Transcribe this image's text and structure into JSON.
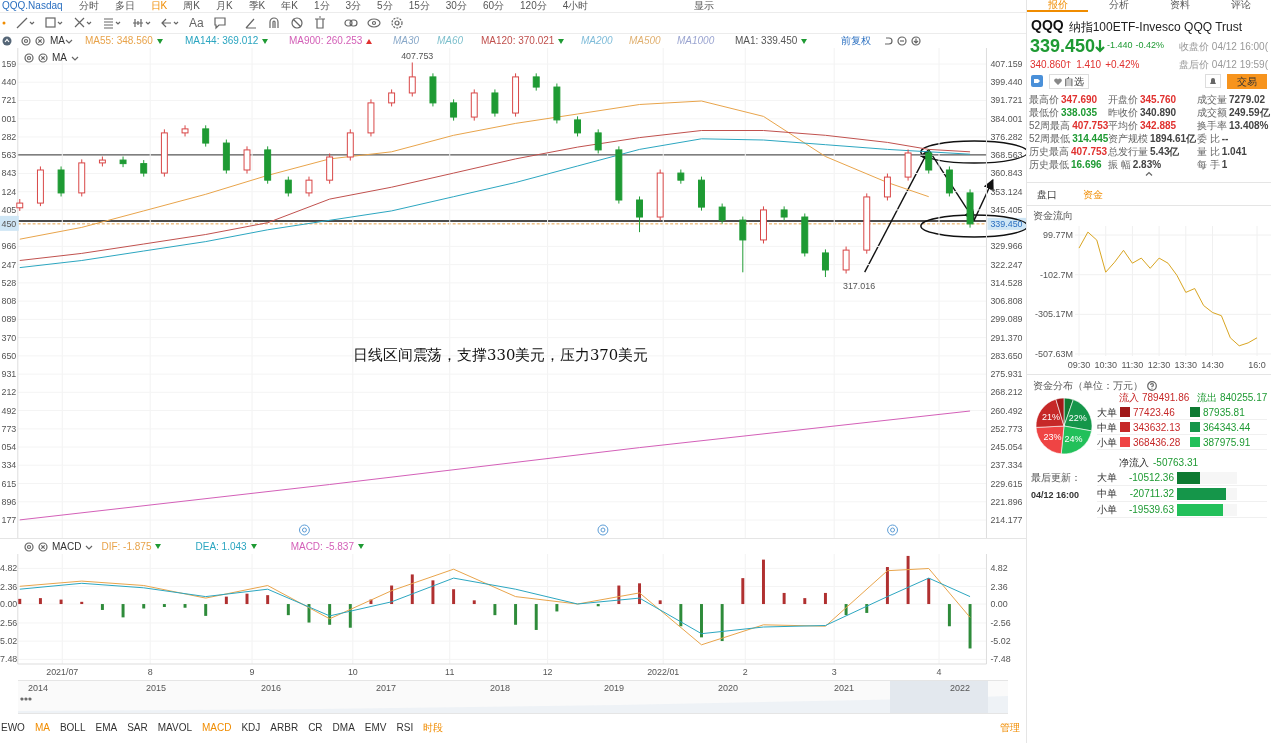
{
  "top_tabs": [
    {
      "label": "QQQ.Nasdaq",
      "selected": false
    },
    {
      "label": "分时",
      "selected": false
    },
    {
      "label": "多日",
      "selected": false
    },
    {
      "label": "日K",
      "selected": true
    },
    {
      "label": "周K",
      "selected": false
    },
    {
      "label": "月K",
      "selected": false
    },
    {
      "label": "季K",
      "selected": false
    },
    {
      "label": "年K",
      "selected": false
    },
    {
      "label": "1分",
      "selected": false
    },
    {
      "label": "3分",
      "selected": false
    },
    {
      "label": "5分",
      "selected": false
    },
    {
      "label": "15分",
      "selected": false
    },
    {
      "label": "30分",
      "selected": false
    },
    {
      "label": "60分",
      "selected": false
    },
    {
      "label": "120分",
      "selected": false
    },
    {
      "label": "4小时",
      "selected": false
    }
  ],
  "display_menu": "显示",
  "text_tool": "Aa",
  "legend_indicator": "MA",
  "ma_legend": [
    {
      "label": "MA55: 348.560",
      "color": "#e8a34a",
      "enabled": true,
      "rising": false
    },
    {
      "label": "MA144: 369.012",
      "color": "#2aa5c0",
      "enabled": true,
      "rising": false
    },
    {
      "label": "MA900: 260.253",
      "color": "#d35fb7",
      "enabled": true,
      "rising": true
    },
    {
      "label": "MA30",
      "color": "#8aa9c9",
      "enabled": false
    },
    {
      "label": "MA60",
      "color": "#7cbfcc",
      "enabled": false
    },
    {
      "label": "MA120: 370.021",
      "color": "#c0504d",
      "enabled": true,
      "rising": false
    },
    {
      "label": "MA200",
      "color": "#7fbcd9",
      "enabled": false
    },
    {
      "label": "MA500",
      "color": "#e0b070",
      "enabled": false
    },
    {
      "label": "MA1000",
      "color": "#9aa4d0",
      "enabled": false
    },
    {
      "label": "MA1: 339.450",
      "color": "#555555",
      "enabled": true,
      "rising": false
    }
  ],
  "adjust_label": "前复权",
  "main_indicator": "MA",
  "main_chart": {
    "chart_data": {
      "type": "candlestick",
      "grid": true,
      "ylim": [
        214.177,
        407.159
      ],
      "yticks": [
        {
          "value": 407.159,
          "label": "407.159"
        },
        {
          "value": 399.44,
          "label": "399.440"
        },
        {
          "value": 391.721,
          "label": "391.721"
        },
        {
          "value": 384.001,
          "label": "384.001"
        },
        {
          "value": 376.282,
          "label": "376.282"
        },
        {
          "value": 368.563,
          "label": "368.563"
        },
        {
          "value": 360.843,
          "label": "360.843"
        },
        {
          "value": 353.124,
          "label": "353.124"
        },
        {
          "value": 345.405,
          "label": "345.405"
        },
        {
          "value": 329.966,
          "label": "329.966"
        },
        {
          "value": 322.247,
          "label": "322.247"
        },
        {
          "value": 314.528,
          "label": "314.528"
        },
        {
          "value": 306.808,
          "label": "306.808"
        },
        {
          "value": 299.089,
          "label": "299.089"
        },
        {
          "value": 291.37,
          "label": "291.370"
        },
        {
          "value": 283.65,
          "label": "283.650"
        },
        {
          "value": 275.931,
          "label": "275.931"
        },
        {
          "value": 268.212,
          "label": "268.212"
        },
        {
          "value": 260.492,
          "label": "260.492"
        },
        {
          "value": 252.773,
          "label": "252.773"
        },
        {
          "value": 245.054,
          "label": "245.054"
        },
        {
          "value": 237.334,
          "label": "237.334"
        },
        {
          "value": 229.615,
          "label": "229.615"
        },
        {
          "value": 221.896,
          "label": "221.896"
        },
        {
          "value": 214.177,
          "label": "214.177"
        }
      ],
      "ohlc": [
        [
          346.3,
          350,
          345,
          348.3
        ],
        [
          348.3,
          363.8,
          347,
          362.3
        ],
        [
          362.3,
          363.8,
          351.1,
          352.6
        ],
        [
          352.6,
          366.8,
          351.1,
          365.3
        ],
        [
          365.3,
          368,
          363.8,
          366.5
        ],
        [
          366.5,
          368,
          363.5,
          365
        ],
        [
          365,
          366.5,
          359.5,
          361
        ],
        [
          361,
          379.5,
          359.5,
          378
        ],
        [
          378,
          381.2,
          376.5,
          379.7
        ],
        [
          379.7,
          381.2,
          372.2,
          373.7
        ],
        [
          373.7,
          375.2,
          360.8,
          362.3
        ],
        [
          362.3,
          372.3,
          360.8,
          370.8
        ],
        [
          370.8,
          372.3,
          356.5,
          358
        ],
        [
          358,
          359.5,
          351.1,
          352.6
        ],
        [
          352.6,
          359.5,
          351.1,
          358
        ],
        [
          358,
          369.3,
          356.5,
          367.8
        ],
        [
          367.8,
          379.5,
          366.3,
          378
        ],
        [
          378,
          392.2,
          376.5,
          390.7
        ],
        [
          390.7,
          396.4,
          389.2,
          394.9
        ],
        [
          394.9,
          407.8,
          393.4,
          401.7
        ],
        [
          401.7,
          403.2,
          389.2,
          390.7
        ],
        [
          390.7,
          392.2,
          383.2,
          384.7
        ],
        [
          384.7,
          396.4,
          383.2,
          394.9
        ],
        [
          394.9,
          396.4,
          384.9,
          386.4
        ],
        [
          386.4,
          403.2,
          384.9,
          401.7
        ],
        [
          401.7,
          403.2,
          395.9,
          397.4
        ],
        [
          397.4,
          398.9,
          382,
          383.5
        ],
        [
          383.5,
          385,
          376.5,
          378
        ],
        [
          378,
          379.5,
          369.3,
          370.8
        ],
        [
          370.8,
          372.3,
          348.1,
          349.6
        ],
        [
          349.6,
          351.1,
          336,
          342.4
        ],
        [
          342.4,
          362.5,
          340.9,
          361
        ],
        [
          361,
          362.5,
          356.5,
          358
        ],
        [
          358,
          359.5,
          345.1,
          346.6
        ],
        [
          346.6,
          348.1,
          339.6,
          341.1
        ],
        [
          341.1,
          342.6,
          319,
          332.7
        ],
        [
          332.7,
          346.9,
          331.2,
          345.4
        ],
        [
          345.4,
          346.9,
          340.9,
          342.4
        ],
        [
          342.4,
          343.9,
          325.7,
          327.2
        ],
        [
          327.2,
          328.7,
          317,
          320
        ],
        [
          320,
          329.9,
          318.5,
          328.4
        ],
        [
          328.4,
          352.4,
          326.9,
          350.9
        ],
        [
          350.9,
          360.8,
          349.4,
          359.3
        ],
        [
          359.3,
          371,
          357.8,
          369.5
        ],
        [
          369.5,
          371,
          360.8,
          362.3
        ],
        [
          362.3,
          363.8,
          351.1,
          352.6
        ],
        [
          352.6,
          354.1,
          337.9,
          339.5
        ]
      ],
      "series": [
        {
          "type": "line",
          "color": "#e8a34a",
          "values": [
            333,
            null,
            null,
            338,
            null,
            null,
            345,
            null,
            null,
            352,
            null,
            null,
            360,
            null,
            null,
            367,
            null,
            null,
            370,
            null,
            null,
            377,
            null,
            null,
            382,
            null,
            null,
            386,
            null,
            null,
            390,
            null,
            null,
            391.5,
            null,
            null,
            385,
            null,
            null,
            368,
            null,
            null,
            357,
            null,
            351,
            null,
            null
          ]
        },
        {
          "type": "line",
          "color": "#c0504d",
          "values": [
            324,
            null,
            null,
            327,
            null,
            null,
            331,
            null,
            null,
            335,
            null,
            null,
            340,
            null,
            null,
            350,
            null,
            null,
            355,
            null,
            null,
            361,
            null,
            null,
            367,
            null,
            null,
            372,
            null,
            null,
            376,
            null,
            null,
            379,
            null,
            null,
            379,
            null,
            null,
            377,
            null,
            null,
            374,
            null,
            371,
            null,
            370
          ]
        },
        {
          "type": "line",
          "color": "#2aa5c0",
          "values": [
            321,
            null,
            null,
            324,
            null,
            null,
            328,
            null,
            null,
            332,
            null,
            null,
            337,
            null,
            null,
            341,
            null,
            null,
            345,
            null,
            null,
            351,
            null,
            null,
            357,
            null,
            null,
            364,
            null,
            null,
            371,
            null,
            null,
            375.5,
            null,
            null,
            375,
            null,
            null,
            373,
            null,
            null,
            371,
            null,
            370,
            null,
            369
          ]
        },
        {
          "type": "line",
          "color": "#d35fb7",
          "values": [
            214.2,
            null,
            null,
            null,
            null,
            null,
            null,
            null,
            null,
            null,
            null,
            null,
            null,
            null,
            null,
            229.2,
            null,
            null,
            null,
            null,
            null,
            null,
            null,
            null,
            null,
            null,
            null,
            null,
            null,
            null,
            244.8,
            null,
            null,
            null,
            null,
            null,
            null,
            null,
            null,
            null,
            null,
            null,
            null,
            null,
            null,
            null,
            260.3
          ]
        }
      ],
      "annotations": [
        {
          "text": "407.753"
        },
        {
          "text": "317.016"
        },
        {
          "text": "日线区间震荡，支撑330美元，压力370美元"
        }
      ]
    },
    "last_price": "339.450",
    "left_axis_labels": [
      "159",
      "440",
      "721",
      "001",
      "282",
      "563",
      "843",
      "124",
      "405",
      "450",
      "966",
      "247",
      "528",
      "808",
      "089",
      "370",
      "650",
      "931",
      "212",
      "492",
      "773",
      "054",
      "334",
      "615",
      "896",
      "177"
    ]
  },
  "macd_legend": {
    "name": "MACD",
    "items": [
      {
        "label": "DIF: -1.875",
        "color": "#e8a34a"
      },
      {
        "label": "DEA: 1.043",
        "color": "#2aa5c0"
      },
      {
        "label": "MACD: -5.837",
        "color": "#d35fb7"
      }
    ]
  },
  "macd_chart": {
    "chart_data": {
      "type": "bar",
      "grid": true,
      "ylim": [
        -8.1,
        6.76
      ],
      "yticks": [
        {
          "value": 4.82,
          "label": "4.82"
        },
        {
          "value": 2.36,
          "label": "2.36"
        },
        {
          "value": 0,
          "label": "0.00"
        },
        {
          "value": -2.56,
          "label": "-2.56"
        },
        {
          "value": -5.02,
          "label": "-5.02"
        },
        {
          "value": -7.48,
          "label": "-7.48"
        }
      ],
      "series": [
        {
          "type": "bar",
          "color": "#b03030",
          "values": [
            0.7,
            0.8,
            0.6,
            0.3,
            null,
            null,
            null,
            null,
            null,
            null,
            1,
            1.4,
            1.2,
            null,
            null,
            null,
            null,
            0.6,
            2.5,
            4,
            3.2,
            2,
            0.5,
            null,
            null,
            null,
            null,
            null,
            null,
            2.5,
            2.8,
            0.5,
            null,
            null,
            null,
            3.5,
            6,
            1.5,
            0.8,
            1.5,
            null,
            null,
            5,
            6.5,
            3.5,
            null,
            null
          ]
        },
        {
          "type": "bar",
          "color": "#2e8b3a",
          "values": [
            null,
            null,
            null,
            null,
            -0.8,
            -1.8,
            -0.6,
            -0.4,
            -0.5,
            -1.6,
            null,
            null,
            null,
            -1.5,
            -2.5,
            -2.8,
            -3.2,
            null,
            null,
            null,
            null,
            null,
            null,
            -1.5,
            -2.8,
            -3.5,
            -1,
            null,
            -0.3,
            null,
            null,
            null,
            -3,
            -4.5,
            -5,
            null,
            null,
            null,
            null,
            null,
            -1.5,
            -1.2,
            null,
            null,
            null,
            -3,
            -6
          ]
        },
        {
          "type": "line",
          "color": "#e8a34a",
          "values": [
            2.4,
            null,
            null,
            3.1,
            null,
            null,
            2.5,
            null,
            null,
            0.8,
            null,
            null,
            2.5,
            null,
            null,
            -2,
            null,
            null,
            1.8,
            null,
            null,
            4.7,
            null,
            null,
            1,
            null,
            null,
            0,
            null,
            null,
            1.5,
            null,
            null,
            -5.5,
            null,
            null,
            -2.8,
            null,
            null,
            -3,
            null,
            null,
            4.5,
            null,
            4.8,
            null,
            -1.8
          ]
        },
        {
          "type": "line",
          "color": "#2aa5c0",
          "values": [
            2,
            null,
            null,
            2.8,
            null,
            null,
            2.2,
            null,
            null,
            1,
            null,
            null,
            2,
            null,
            null,
            -1.6,
            null,
            null,
            0.3,
            null,
            null,
            3.5,
            null,
            null,
            2,
            null,
            null,
            0,
            null,
            null,
            0.8,
            null,
            null,
            -4,
            null,
            null,
            -3.1,
            null,
            null,
            -2.9,
            null,
            null,
            1,
            null,
            3.5,
            null,
            1
          ]
        }
      ]
    },
    "left_axis_labels": [
      "4.82",
      "2.36",
      "0.00",
      "2.56",
      "5.02",
      "7.48"
    ]
  },
  "x_axis_labels": [
    "2021/07",
    "8",
    "9",
    "10",
    "11",
    "12",
    "2022/01",
    "2",
    "3",
    "4"
  ],
  "navigator_years": [
    "2014",
    "2015",
    "2016",
    "2017",
    "2018",
    "2019",
    "2020",
    "2021",
    "2022"
  ],
  "indicator_tabs": [
    {
      "label": "EWO",
      "selected": false
    },
    {
      "label": "MA",
      "selected": true
    },
    {
      "label": "BOLL",
      "selected": false
    },
    {
      "label": "EMA",
      "selected": false
    },
    {
      "label": "SAR",
      "selected": false
    },
    {
      "label": "MAVOL",
      "selected": false
    },
    {
      "label": "MACD",
      "selected": true
    },
    {
      "label": "KDJ",
      "selected": false
    },
    {
      "label": "ARBR",
      "selected": false
    },
    {
      "label": "CR",
      "selected": false
    },
    {
      "label": "DMA",
      "selected": false
    },
    {
      "label": "EMV",
      "selected": false
    },
    {
      "label": "RSI",
      "selected": false
    },
    {
      "label": "时段",
      "selected": true
    }
  ],
  "manage_label": "管理",
  "panel_tabs": [
    {
      "label": "报价",
      "selected": true
    },
    {
      "label": "分析",
      "selected": false
    },
    {
      "label": "资料",
      "selected": false
    },
    {
      "label": "评论",
      "selected": false
    }
  ],
  "quote": {
    "symbol": "QQQ",
    "name": "纳指100ETF-Invesco QQQ Trust",
    "price": "339.450",
    "rising": false,
    "change": "-1.440",
    "change_pct": "-0.42%",
    "close_time": "收盘价 04/12 16:00(",
    "after_price": "340.860",
    "after_rising": true,
    "after_change": "1.410",
    "after_change_pct": "+0.42%",
    "after_time": "盘后价 04/12 19:59(",
    "watch_label": "自选",
    "trade_label": "交易",
    "stats": [
      [
        {
          "label": "最高价",
          "value": "347.690",
          "color": "#e0312f"
        },
        {
          "label": "开盘价",
          "value": "345.760",
          "color": "#e0312f"
        },
        {
          "label": "成交量",
          "value": "7279.02",
          "color": "#444444"
        }
      ],
      [
        {
          "label": "最低价",
          "value": "338.035",
          "color": "#1e9a33"
        },
        {
          "label": "昨收价",
          "value": "340.890",
          "color": "#444444"
        },
        {
          "label": "成交额",
          "value": "249.59亿",
          "color": "#444444"
        }
      ],
      [
        {
          "label": "52周最高",
          "value": "407.753",
          "color": "#e0312f"
        },
        {
          "label": "平均价",
          "value": "342.885",
          "color": "#e0312f"
        },
        {
          "label": "换手率",
          "value": "13.408%",
          "color": "#444444"
        }
      ],
      [
        {
          "label": "52周最低",
          "value": "314.445",
          "color": "#1e9a33"
        },
        {
          "label": "资产规模",
          "value": "1894.61亿",
          "color": "#444444"
        },
        {
          "label": "委 比",
          "value": "--",
          "color": "#444444"
        }
      ],
      [
        {
          "label": "历史最高",
          "value": "407.753",
          "color": "#e0312f"
        },
        {
          "label": "总发行量",
          "value": "5.43亿",
          "color": "#444444"
        },
        {
          "label": "量 比",
          "value": "1.041",
          "color": "#444444"
        }
      ],
      [
        {
          "label": "历史最低",
          "value": "16.696",
          "color": "#1e9a33"
        },
        {
          "label": "振 幅",
          "value": "2.83%",
          "color": "#444444"
        },
        {
          "label": "每 手",
          "value": "1",
          "color": "#444444"
        }
      ]
    ]
  },
  "sub_tabs": [
    {
      "label": "盘口",
      "selected": false
    },
    {
      "label": "资金",
      "selected": true
    }
  ],
  "fund_flow": {
    "title": "资金流向",
    "chart_data": {
      "type": "line",
      "grid": true,
      "categories": [
        "09:30",
        null,
        null,
        "10:30",
        null,
        null,
        "11:30",
        null,
        null,
        "12:30",
        null,
        null,
        "13:30",
        null,
        null,
        "14:30",
        null,
        null,
        null,
        null,
        "16:0"
      ],
      "ylim": [
        -518,
        146
      ],
      "yticks": [
        {
          "value": 99.77,
          "label": "99.77M"
        },
        {
          "value": -102.7,
          "label": "-102.7M"
        },
        {
          "value": -305.17,
          "label": "-305.17M"
        },
        {
          "value": -507.63,
          "label": "-507.63M"
        }
      ],
      "series": [
        {
          "color": "#d9a521",
          "values": [
            33,
            115,
            74,
            -90,
            -39,
            22,
            -44,
            -18,
            -70,
            -18,
            -44,
            -106,
            -193,
            -173,
            -260,
            -296,
            -312,
            -425,
            -466,
            -451,
            -425
          ]
        }
      ]
    }
  },
  "fund_distribution": {
    "title": "资金分布（单位：万元）",
    "inflow_label": "流入",
    "inflow_total": "789491.86",
    "outflow_label": "流出",
    "outflow_total": "840255.17",
    "rows": [
      {
        "label": "大单",
        "inflow": {
          "value": "77423.46",
          "color": "#a01818"
        },
        "outflow": {
          "value": "87935.81",
          "color": "#0e7a32"
        }
      },
      {
        "label": "中单",
        "inflow": {
          "value": "343632.13",
          "color": "#c62828"
        },
        "outflow": {
          "value": "364343.44",
          "color": "#15964a"
        }
      },
      {
        "label": "小单",
        "inflow": {
          "value": "368436.28",
          "color": "#ef4444"
        },
        "outflow": {
          "value": "387975.91",
          "color": "#22c05a"
        }
      }
    ],
    "chart_data": {
      "type": "pie",
      "series": [
        {
          "values": [
            5.4,
            22.4,
            23.8,
            22.6,
            21.1,
            4.7
          ]
        }
      ],
      "value_labels": [
        null,
        "22%",
        "24%",
        "23%",
        "21%",
        null
      ]
    },
    "last_update_label": "最后更新：",
    "last_update": "04/12 16:00",
    "net_label": "净流入",
    "net_total": "-50763.31",
    "net_rows": [
      {
        "label": "大单",
        "value": "-10512.36",
        "level": 0.38
      },
      {
        "label": "中单",
        "value": "-20711.32",
        "level": 0.82
      },
      {
        "label": "小单",
        "value": "-19539.63",
        "level": 0.77
      }
    ]
  }
}
